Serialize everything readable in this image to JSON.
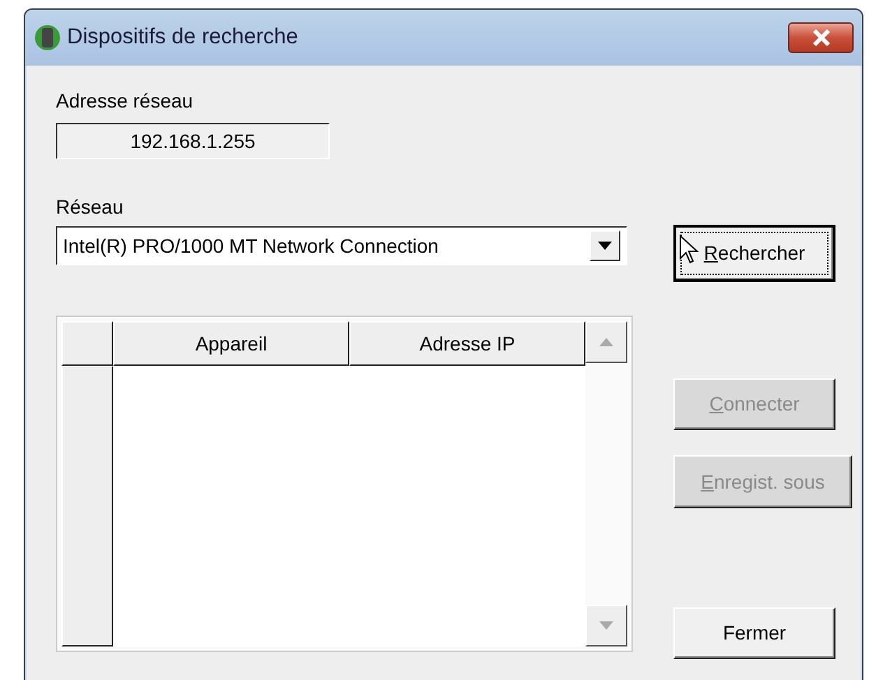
{
  "window": {
    "title": "Dispositifs de recherche"
  },
  "network_address": {
    "label": "Adresse réseau",
    "value": "192.168.1.255"
  },
  "network": {
    "label": "Réseau",
    "value": "Intel(R) PRO/1000 MT Network Connection"
  },
  "device_table": {
    "columns": [
      "Appareil",
      "Adresse IP"
    ]
  },
  "buttons": [
    {
      "label": "Rechercher",
      "mnemonic": true,
      "disabled": false,
      "focused": true
    },
    {
      "label": "Connecter",
      "mnemonic": true,
      "disabled": true,
      "focused": false
    },
    {
      "label": "Enregist. sous",
      "mnemonic": true,
      "disabled": true,
      "focused": false
    },
    {
      "label": "Fermer",
      "mnemonic": false,
      "disabled": false,
      "focused": false
    }
  ]
}
